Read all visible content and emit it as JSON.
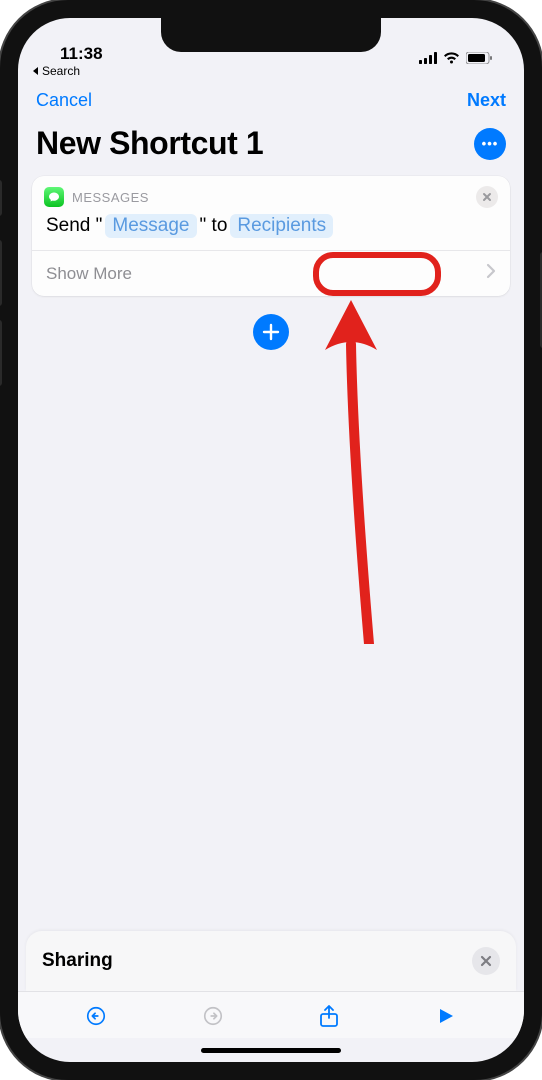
{
  "statusbar": {
    "time": "11:38"
  },
  "breadcrumb": {
    "label": "Search"
  },
  "nav": {
    "cancel": "Cancel",
    "next": "Next"
  },
  "header": {
    "title": "New Shortcut 1"
  },
  "action": {
    "app_label": "MESSAGES",
    "prefix": "Send \"",
    "token_message": "Message",
    "middle": "\" to",
    "token_recipients": "Recipients",
    "show_more": "Show More"
  },
  "sharing": {
    "label": "Sharing"
  }
}
